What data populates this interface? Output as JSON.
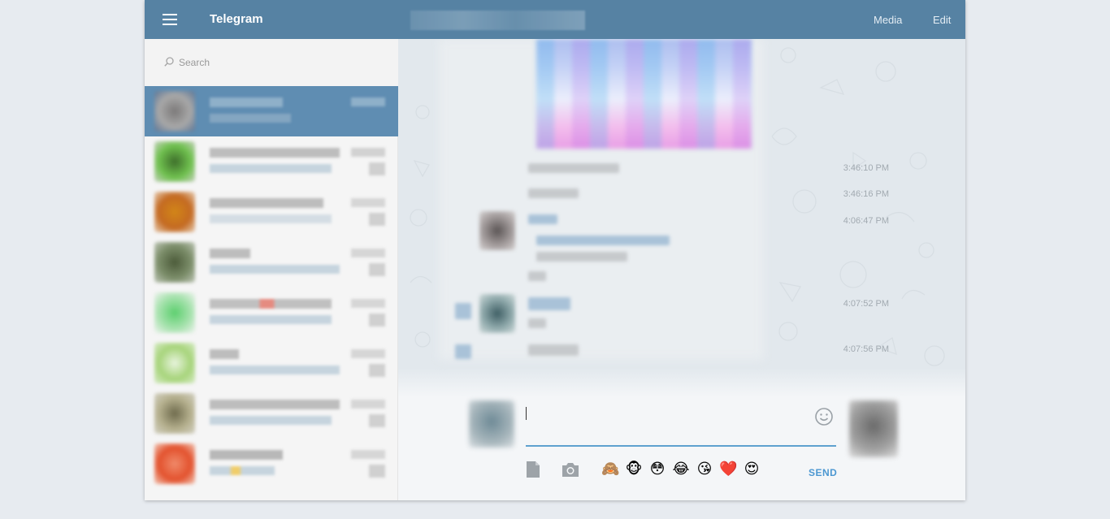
{
  "header": {
    "app_title": "Telegram",
    "media_label": "Media",
    "edit_label": "Edit"
  },
  "sidebar": {
    "search_placeholder": "Search"
  },
  "chat": {
    "timestamps": [
      "3:46:10 PM",
      "3:46:16 PM",
      "4:06:47 PM",
      "4:07:52 PM",
      "4:07:56 PM"
    ]
  },
  "composer": {
    "quick_emoji": [
      "🙈",
      "🐵",
      "😳",
      "😂",
      "😘",
      "❤️",
      "😍"
    ],
    "send_label": "SEND",
    "icons": {
      "attach_file": "file-icon",
      "attach_photo": "camera-icon",
      "emoji": "smiley-icon"
    }
  },
  "colors": {
    "header": "#5682a3",
    "active_dialog": "#5f8db2",
    "accent": "#4b97d1"
  }
}
